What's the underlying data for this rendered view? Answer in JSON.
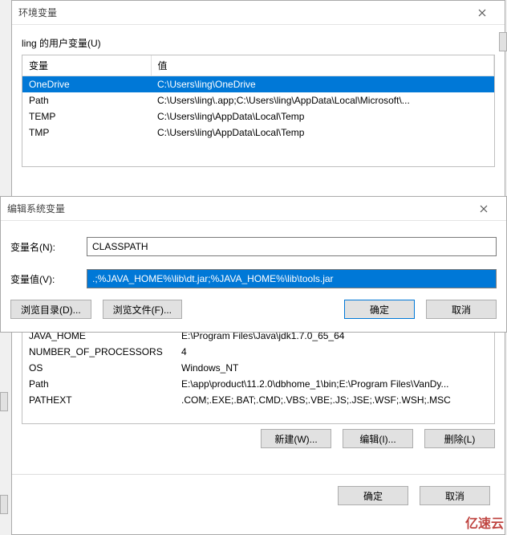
{
  "env_window": {
    "title": "环境变量",
    "user_section_label": "ling 的用户变量(U)",
    "columns": {
      "var": "变量",
      "val": "值"
    },
    "user_vars": [
      {
        "name": "OneDrive",
        "value": "C:\\Users\\ling\\OneDrive",
        "selected": true
      },
      {
        "name": "Path",
        "value": "C:\\Users\\ling\\.app;C:\\Users\\ling\\AppData\\Local\\Microsoft\\..."
      },
      {
        "name": "TEMP",
        "value": "C:\\Users\\ling\\AppData\\Local\\Temp"
      },
      {
        "name": "TMP",
        "value": "C:\\Users\\ling\\AppData\\Local\\Temp"
      }
    ],
    "sys_vars": [
      {
        "name": "JAVA_HOME",
        "value": "E:\\Program Files\\Java\\jdk1.7.0_65_64"
      },
      {
        "name": "NUMBER_OF_PROCESSORS",
        "value": "4"
      },
      {
        "name": "OS",
        "value": "Windows_NT"
      },
      {
        "name": "Path",
        "value": "E:\\app\\product\\11.2.0\\dbhome_1\\bin;E:\\Program Files\\VanDy..."
      },
      {
        "name": "PATHEXT",
        "value": ".COM;.EXE;.BAT;.CMD;.VBS;.VBE;.JS;.JSE;.WSF;.WSH;.MSC"
      }
    ],
    "buttons": {
      "new": "新建(W)...",
      "edit": "编辑(I)...",
      "delete": "删除(L)",
      "ok": "确定",
      "cancel": "取消"
    }
  },
  "edit_window": {
    "title": "编辑系统变量",
    "name_label": "变量名(N):",
    "value_label": "变量值(V):",
    "name_value": "CLASSPATH",
    "value_value": ".;%JAVA_HOME%\\lib\\dt.jar;%JAVA_HOME%\\lib\\tools.jar",
    "buttons": {
      "browse_dir": "浏览目录(D)...",
      "browse_file": "浏览文件(F)...",
      "ok": "确定",
      "cancel": "取消"
    }
  },
  "watermark": "亿速云"
}
